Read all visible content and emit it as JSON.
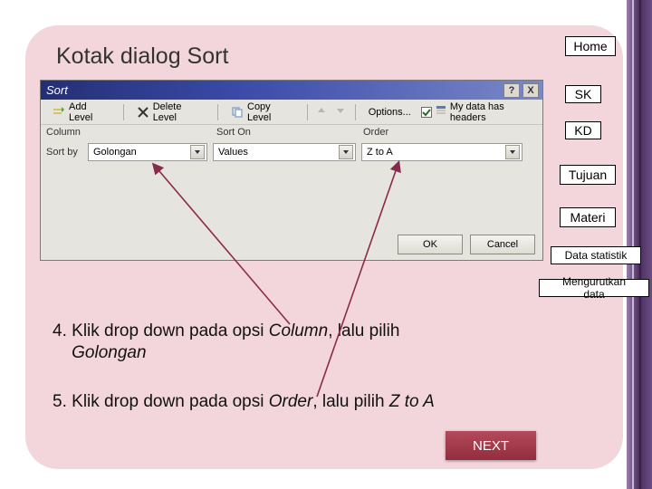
{
  "slide": {
    "title": "Kotak dialog Sort"
  },
  "dialog": {
    "title": "Sort",
    "help_label": "?",
    "close_label": "X",
    "toolbar": {
      "add_level": "Add Level",
      "delete_level": "Delete Level",
      "copy_level": "Copy Level",
      "options": "Options...",
      "headers_label": "My data has headers"
    },
    "headers": {
      "column": "Column",
      "sort_on": "Sort On",
      "order": "Order"
    },
    "row": {
      "label": "Sort by",
      "column_value": "Golongan",
      "sorton_value": "Values",
      "order_value": "Z to A"
    },
    "footer": {
      "ok": "OK",
      "cancel": "Cancel"
    }
  },
  "nav": {
    "home": "Home",
    "sk": "SK",
    "kd": "KD",
    "tujuan": "Tujuan",
    "materi": "Materi",
    "data_statistik": "Data statistik",
    "mengurutkan": "Mengurutkan data"
  },
  "instructions": {
    "step4_num": "4.",
    "step4_a": "Klik drop down pada opsi ",
    "step4_b": "Column",
    "step4_c": ", lalu pilih ",
    "step4_d": "Golongan",
    "step5_num": "5.",
    "step5_a": "Klik drop down pada opsi ",
    "step5_b": "Order",
    "step5_c": ", lalu pilih ",
    "step5_d": "Z to A"
  },
  "next": "NEXT"
}
